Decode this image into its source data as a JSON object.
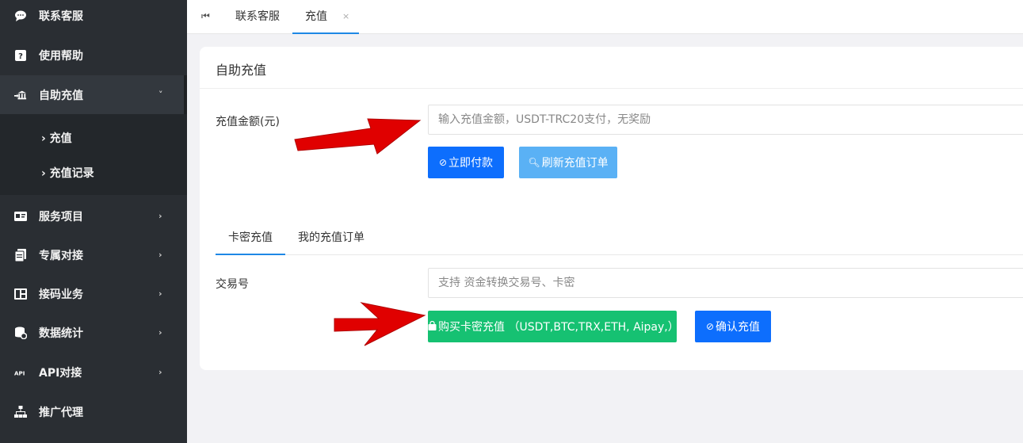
{
  "sidebar": {
    "items": [
      {
        "label": "联系客服",
        "icon": "chat-icon"
      },
      {
        "label": "使用帮助",
        "icon": "help-icon"
      },
      {
        "label": "自助充值",
        "icon": "bank-icon"
      },
      {
        "label": "服务项目",
        "icon": "card-icon"
      },
      {
        "label": "专属对接",
        "icon": "docs-icon"
      },
      {
        "label": "接码业务",
        "icon": "sim-icon"
      },
      {
        "label": "数据统计",
        "icon": "database-icon"
      },
      {
        "label": "API对接",
        "icon": "api-icon"
      },
      {
        "label": "推广代理",
        "icon": "sitemap-icon"
      }
    ],
    "sub_items": [
      {
        "label": "充值"
      },
      {
        "label": "充值记录"
      }
    ]
  },
  "topbar": {
    "tabs": [
      {
        "label": "联系客服"
      },
      {
        "label": "充值"
      }
    ],
    "close_glyph": "×"
  },
  "card": {
    "title": "自助充值",
    "amount_label": "充值金额(元)",
    "amount_placeholder": "输入充值金额，USDT-TRC20支付，无奖励",
    "pay_button": "立即付款",
    "refresh_button": "刷新充值订单",
    "tabs": [
      {
        "label": "卡密充值"
      },
      {
        "label": "我的充值订单"
      }
    ],
    "txn_label": "交易号",
    "txn_placeholder": "支持 资金转换交易号、卡密",
    "buy_button": "购买卡密充值 （USDT,BTC,TRX,ETH, Aipay,）",
    "confirm_button": "确认充值"
  },
  "colors": {
    "sidebar_bg": "#2a2e33",
    "primary": "#0d6efd",
    "success": "#16c172",
    "arrow": "#e00000"
  }
}
